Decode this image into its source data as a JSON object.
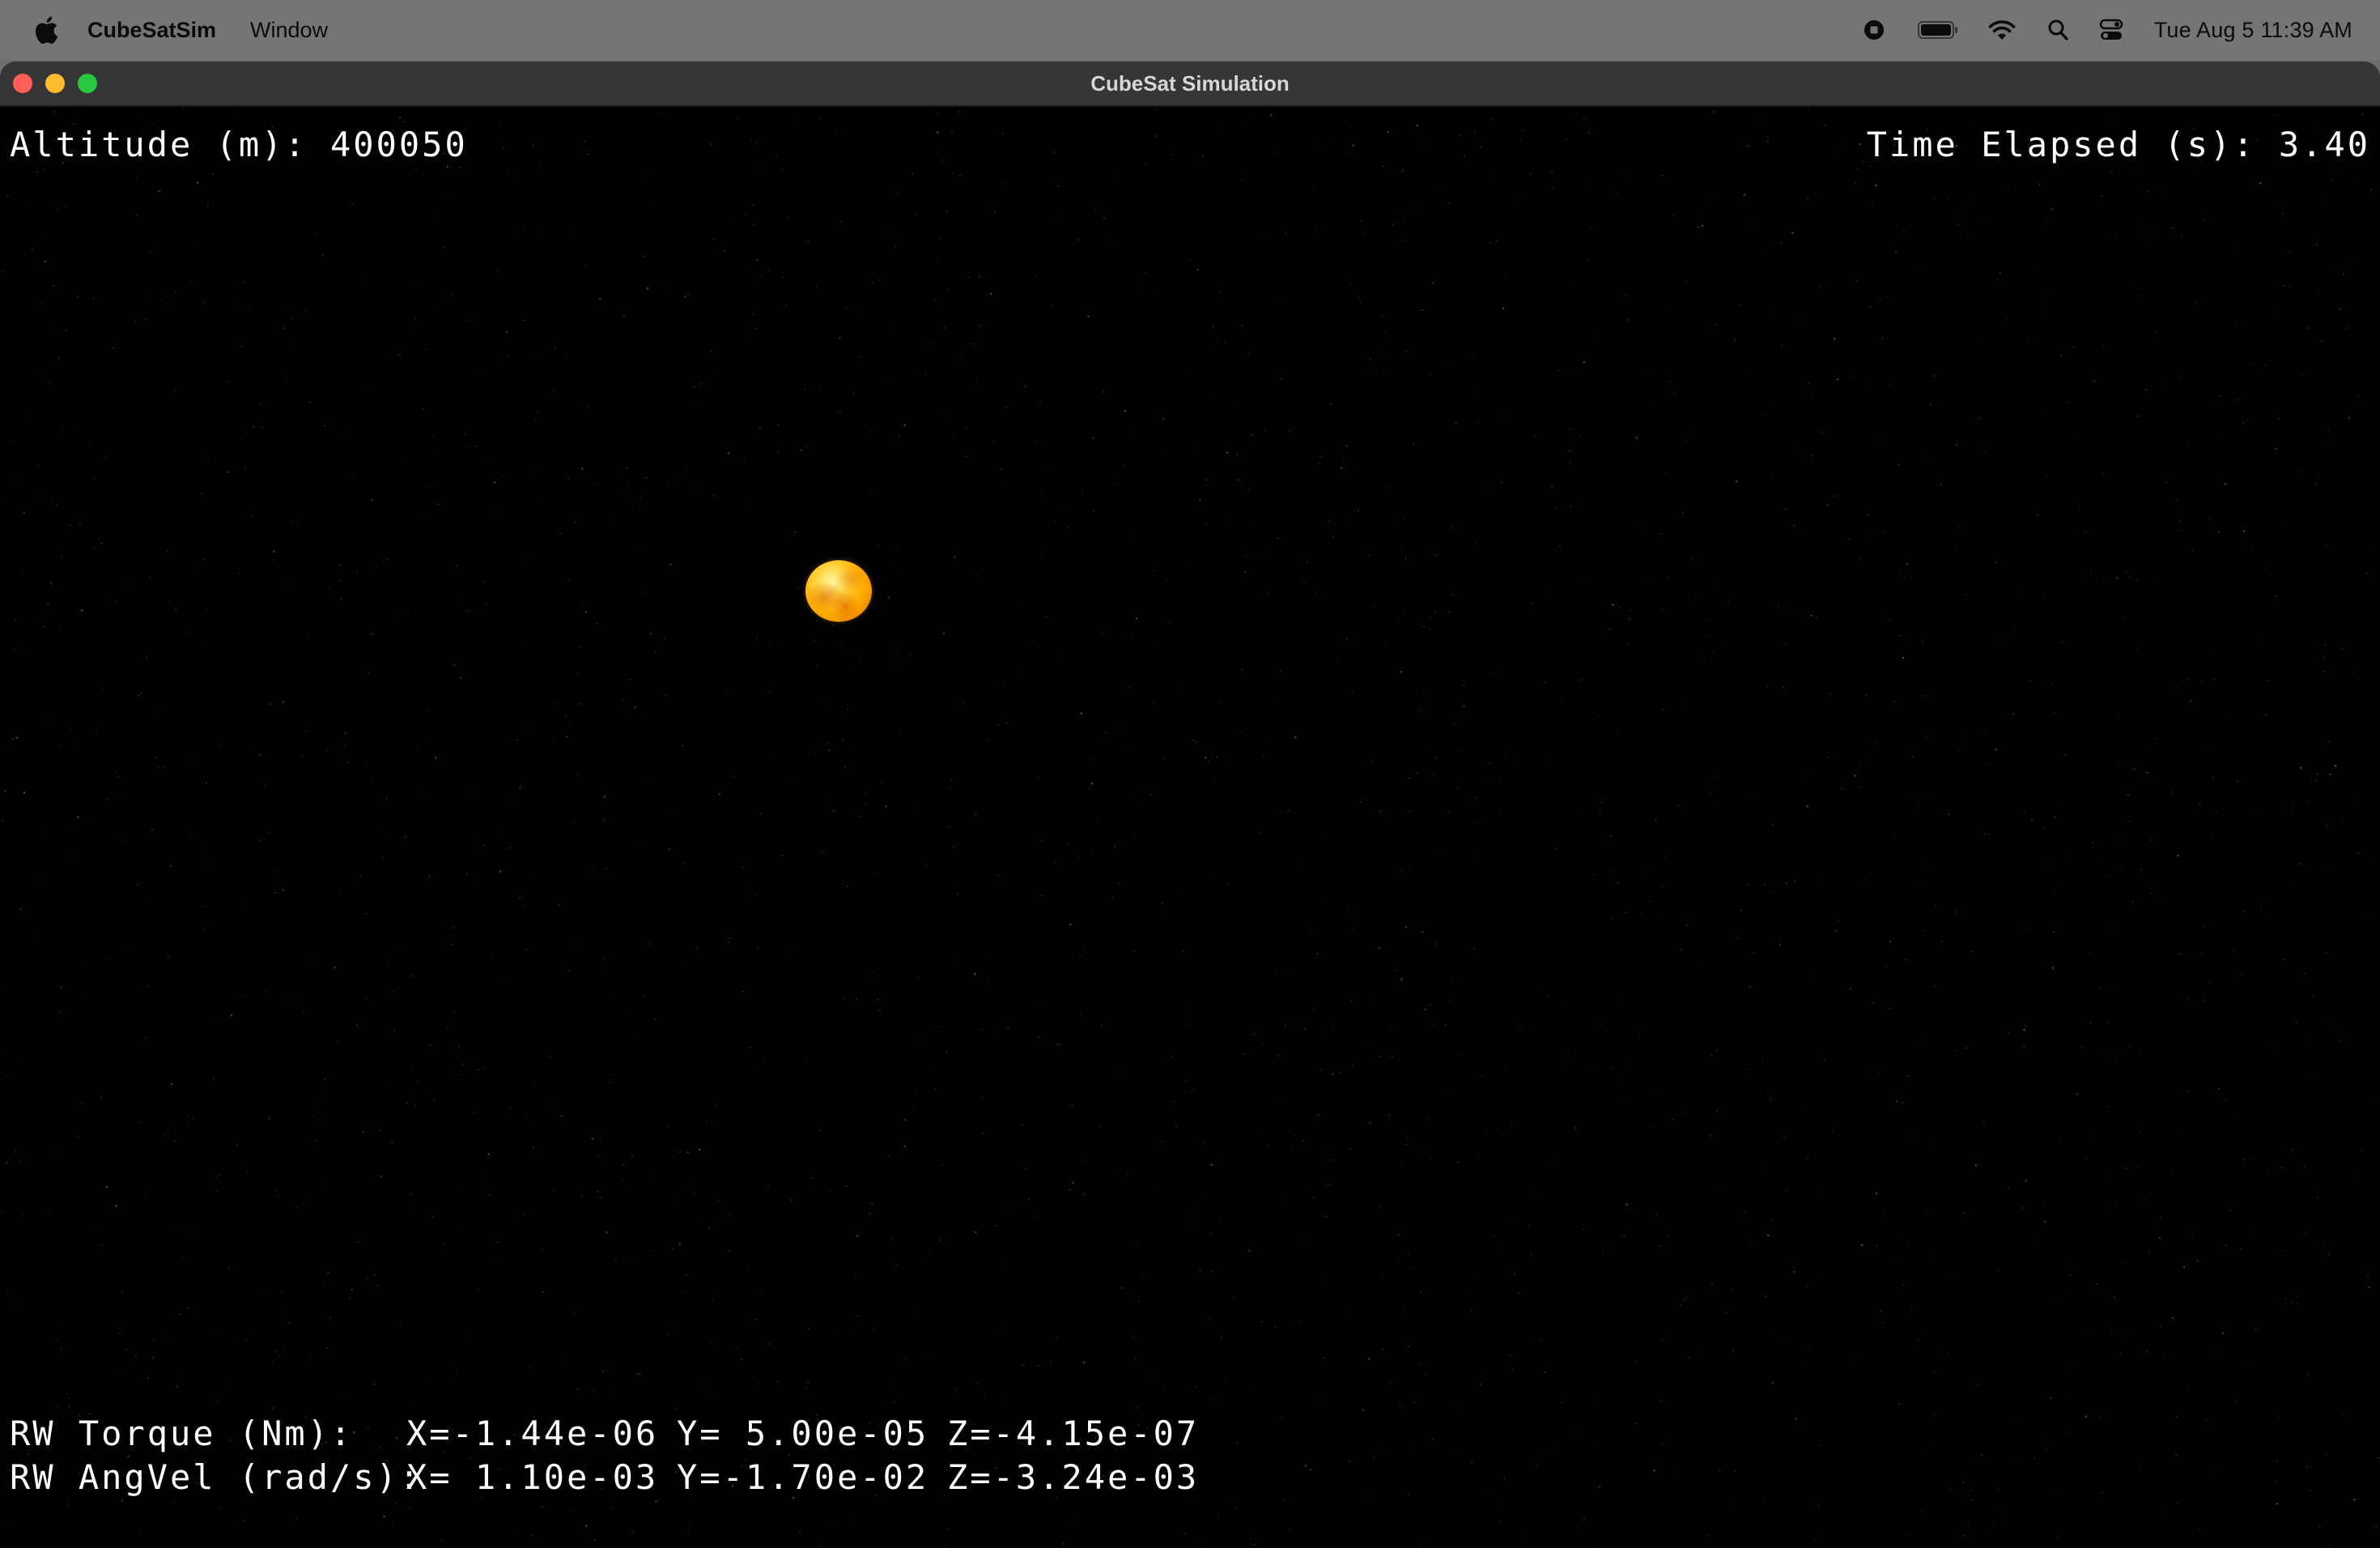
{
  "menubar": {
    "app_name": "CubeSatSim",
    "menu_items": [
      "Window"
    ],
    "clock": "Tue Aug 5  11:39 AM",
    "status_icons": [
      "screen-record-icon",
      "battery-icon",
      "wifi-icon",
      "spotlight-search-icon",
      "control-center-icon"
    ]
  },
  "window": {
    "title": "CubeSat Simulation"
  },
  "hud": {
    "altitude_label": "Altitude (m): ",
    "altitude_value": "400050",
    "time_label": "Time Elapsed (s): ",
    "time_value": "3.40",
    "torque": {
      "label": "RW Torque (Nm):",
      "x": "X=-1.44e-06",
      "y": "Y= 5.00e-05",
      "z": "Z=-4.15e-07"
    },
    "angvel": {
      "label": "RW AngVel (rad/s):",
      "x": "X= 1.10e-03",
      "y": "Y=-1.70e-02",
      "z": "Z=-3.24e-03"
    }
  },
  "colors": {
    "sun": "#ffb000",
    "hud_text": "#ffffff",
    "space": "#000000"
  }
}
